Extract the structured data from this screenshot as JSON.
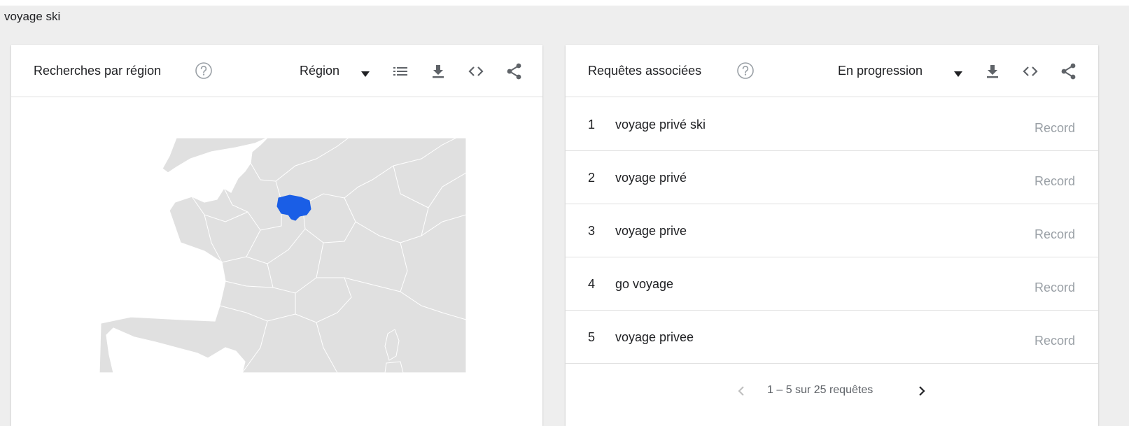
{
  "search_term": "voyage ski",
  "region_card": {
    "title": "Recherches par région",
    "resolution_select": "Région",
    "highlighted_region": "Île-de-France",
    "highlight_color": "#1a5ee6",
    "map_fill": "#e0e0e0",
    "map_stroke": "#ffffff"
  },
  "queries_card": {
    "title": "Requêtes associées",
    "sort_select": "En progression",
    "rows": [
      {
        "rank": "1",
        "query": "voyage privé ski",
        "value": "Record"
      },
      {
        "rank": "2",
        "query": "voyage privé",
        "value": "Record"
      },
      {
        "rank": "3",
        "query": "voyage prive",
        "value": "Record"
      },
      {
        "rank": "4",
        "query": "go voyage",
        "value": "Record"
      },
      {
        "rank": "5",
        "query": "voyage privee",
        "value": "Record"
      }
    ],
    "pagination": "1 – 5 sur 25 requêtes"
  },
  "icons": {
    "help": "help-circle-icon",
    "caret": "caret-down-icon",
    "list": "list-icon",
    "download": "download-icon",
    "embed": "embed-code-icon",
    "share": "share-icon",
    "prev": "chevron-left-icon",
    "next": "chevron-right-icon"
  },
  "colors": {
    "icon": "#5f6368",
    "muted": "#9aa0a6",
    "divider": "#e0e0e0"
  }
}
